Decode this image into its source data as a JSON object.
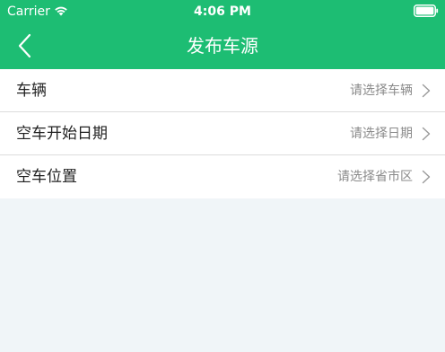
{
  "status_bar": {
    "carrier": "Carrier",
    "time": "4:06 PM",
    "wifi_icon": "wifi-icon",
    "battery_icon": "battery-full-icon"
  },
  "nav": {
    "title": "发布车源",
    "back_icon": "chevron-left-icon"
  },
  "form": {
    "rows": [
      {
        "label": "车辆",
        "placeholder": "请选择车辆"
      },
      {
        "label": "空车开始日期",
        "placeholder": "请选择日期"
      },
      {
        "label": "空车位置",
        "placeholder": "请选择省市区"
      }
    ]
  },
  "colors": {
    "header_green": "#1dbd73",
    "background": "#f0f5f8",
    "placeholder_gray": "#8a8a8a",
    "label_dark": "#222222"
  }
}
